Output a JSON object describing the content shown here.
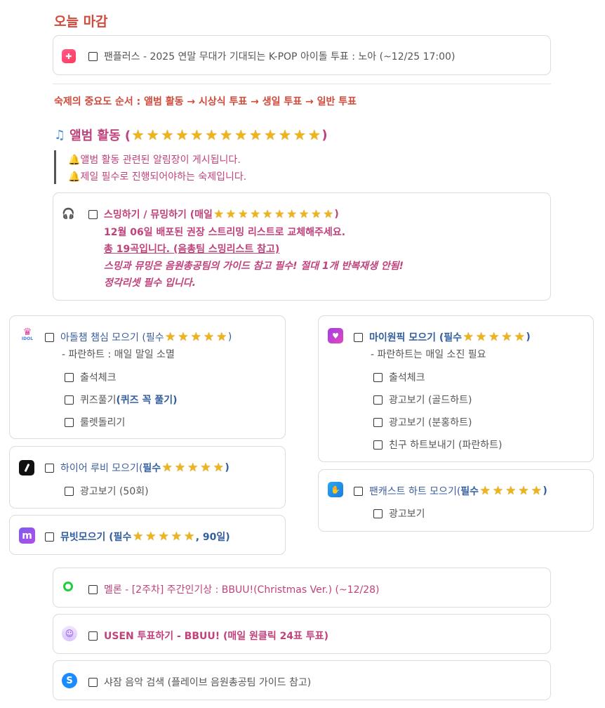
{
  "today": {
    "heading": "오늘 마감",
    "fanplus_text": "팬플러스 - 2025 연말 무대가 기대되는 K-POP 아이돌 투표 : 노아 (~12/25 17:00)"
  },
  "priority_text": "숙제의 중요도 순서 : 앨범 활동 → 시상식 투표 → 생일 투표 → 일반 투표",
  "album": {
    "heading_prefix": "앨범 활동 (",
    "heading_suffix": ")",
    "stars": 13,
    "notes": [
      "앨범 활동 관련된 알림장이 게시됩니다.",
      "제일 필수로 진행되어야하는 숙제입니다."
    ]
  },
  "streaming": {
    "title_prefix": "스밍하기 / 뮤밍하기 (매일",
    "title_suffix": ")",
    "stars": 10,
    "line1": "12월 06일 배포된 권장 스트리밍 리스트로 교체해주세요.",
    "line2": "총 19곡입니다. (음총팀 스밍리스트 참고)",
    "line3": "스밍과 뮤밍은 음원총공팀의 가이드 참고 필수! 절대 1개 반복재생 안됨!",
    "line4": "정각리셋 필수 입니다."
  },
  "idolchamp": {
    "title_prefix": "아돌챔 챔심 모으기 (필수",
    "title_suffix": ")",
    "stars": 5,
    "sub": "- 파란하트 : 매일 말일 소멸",
    "items": [
      "출석체크",
      "퀴즈풀기 ",
      "룰렛돌리기"
    ],
    "quiz_bold": "(퀴즈 꼭 풀기)"
  },
  "mywonpick": {
    "title_prefix": "마이원픽 모으기 (필수",
    "title_suffix": ")",
    "stars": 5,
    "sub": "- 파란하트는 매일 소진 필요",
    "items": [
      "출석체크",
      "광고보기 (골드하트)",
      "광고보기 (분홍하트)",
      "친구 하트보내기 (파란하트)"
    ]
  },
  "hiruby": {
    "title_prefix": "하이어 루비 모으기(",
    "title_bold": "필수",
    "title_suffix": ")",
    "stars": 5,
    "items": [
      "광고보기 (50회)"
    ]
  },
  "fancast": {
    "title_prefix": "팬캐스트 하트 모으기(",
    "title_bold": "필수",
    "title_suffix": ")",
    "stars": 5,
    "items": [
      "광고보기"
    ]
  },
  "mubeat": {
    "title_prefix": "뮤빗모으기 (필수",
    "title_suffix": ", 90일)",
    "stars": 5
  },
  "melon": {
    "text": "멜론 - [2주차] 주간인기상 : BBUU!(Christmas Ver.) (~12/28)"
  },
  "usen": {
    "text": "USEN 투표하기 - BBUU! (매일 원클릭 24표 투표)"
  },
  "shazam": {
    "text": "샤잠 음악 검색 (플레이브 음원총공팀 가이드 참고)"
  },
  "colors": {
    "red": "#d14a3c",
    "pink": "#c0427b",
    "blue": "#335f9e",
    "star": "#f0b41b"
  }
}
